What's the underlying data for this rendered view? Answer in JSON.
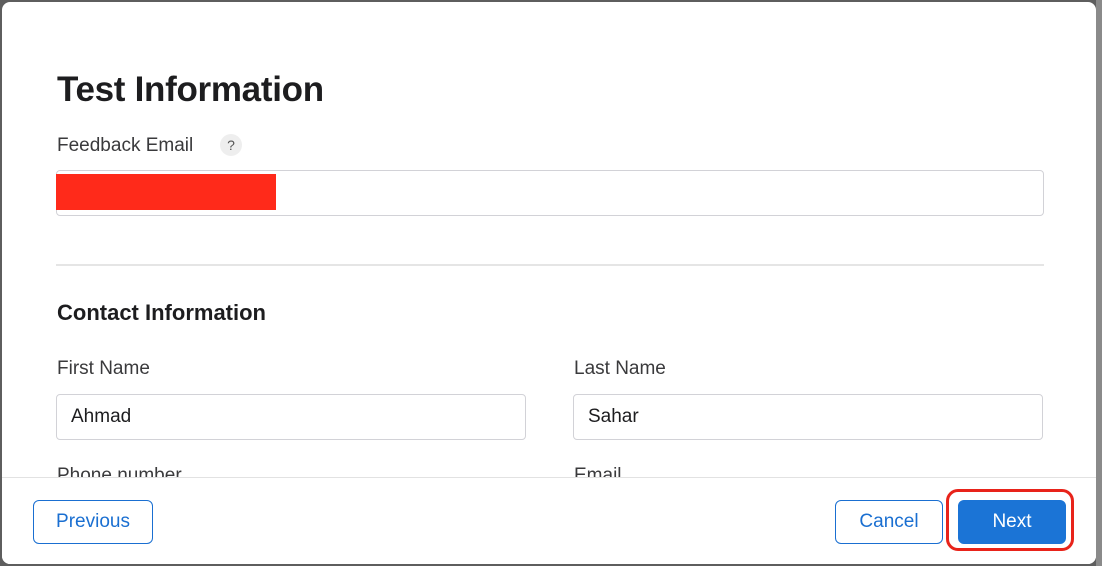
{
  "dialog": {
    "title": "Test Information",
    "feedback_email": {
      "label": "Feedback Email",
      "help": "?",
      "value": ""
    },
    "contact": {
      "section_title": "Contact Information",
      "first_name": {
        "label": "First Name",
        "value": "Ahmad"
      },
      "last_name": {
        "label": "Last Name",
        "value": "Sahar"
      },
      "phone_label": "Phone number",
      "email_label": "Email"
    }
  },
  "footer": {
    "previous_label": "Previous",
    "cancel_label": "Cancel",
    "next_label": "Next"
  },
  "colors": {
    "primary": "#1b74d6",
    "highlight": "#e8231a",
    "redaction": "#ff2a1a"
  }
}
